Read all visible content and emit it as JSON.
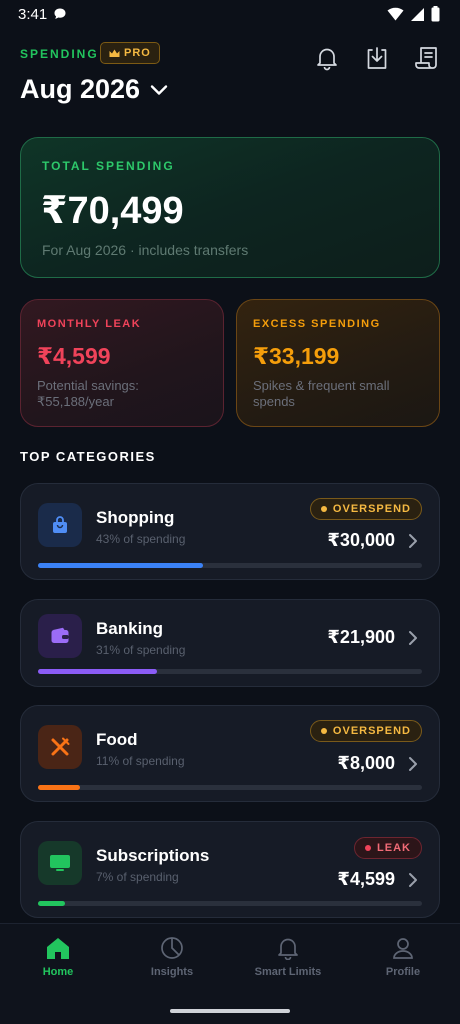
{
  "status_bar": {
    "time": "3:41"
  },
  "header": {
    "section_label": "SPENDING",
    "pro_badge": "PRO",
    "month": "Aug 2026"
  },
  "total_card": {
    "label": "TOTAL SPENDING",
    "value": "₹70,499",
    "subtitle": "For Aug 2026 · includes transfers"
  },
  "leak_card": {
    "label": "MONTHLY LEAK",
    "value": "₹4,599",
    "subtitle": "Potential savings: ₹55,188/year",
    "accent": "#f0435a"
  },
  "excess_card": {
    "label": "EXCESS SPENDING",
    "value": "₹33,199",
    "subtitle": "Spikes & frequent small spends",
    "accent": "#f59e0b"
  },
  "section_title": "TOP CATEGORIES",
  "categories": [
    {
      "name": "Shopping",
      "percent_text": "43% of spending",
      "amount": "₹30,000",
      "badge": "OVERSPEND",
      "share": 0.43,
      "color": "#3b82f6",
      "icon": "shopping-bag-icon"
    },
    {
      "name": "Banking",
      "percent_text": "31% of spending",
      "amount": "₹21,900",
      "badge": "",
      "share": 0.31,
      "color": "#8b5cf6",
      "icon": "wallet-icon"
    },
    {
      "name": "Food",
      "percent_text": "11% of spending",
      "amount": "₹8,000",
      "badge": "OVERSPEND",
      "share": 0.11,
      "color": "#f97316",
      "icon": "utensils-icon"
    },
    {
      "name": "Subscriptions",
      "percent_text": "7% of spending",
      "amount": "₹4,599",
      "badge": "LEAK",
      "share": 0.07,
      "color": "#22c55e",
      "icon": "tv-icon"
    }
  ],
  "bottom_nav": [
    {
      "label": "Home",
      "icon": "home-icon",
      "active": true
    },
    {
      "label": "Insights",
      "icon": "pie-chart-icon",
      "active": false
    },
    {
      "label": "Smart Limits",
      "icon": "bell-icon",
      "active": false
    },
    {
      "label": "Profile",
      "icon": "user-icon",
      "active": false
    }
  ]
}
